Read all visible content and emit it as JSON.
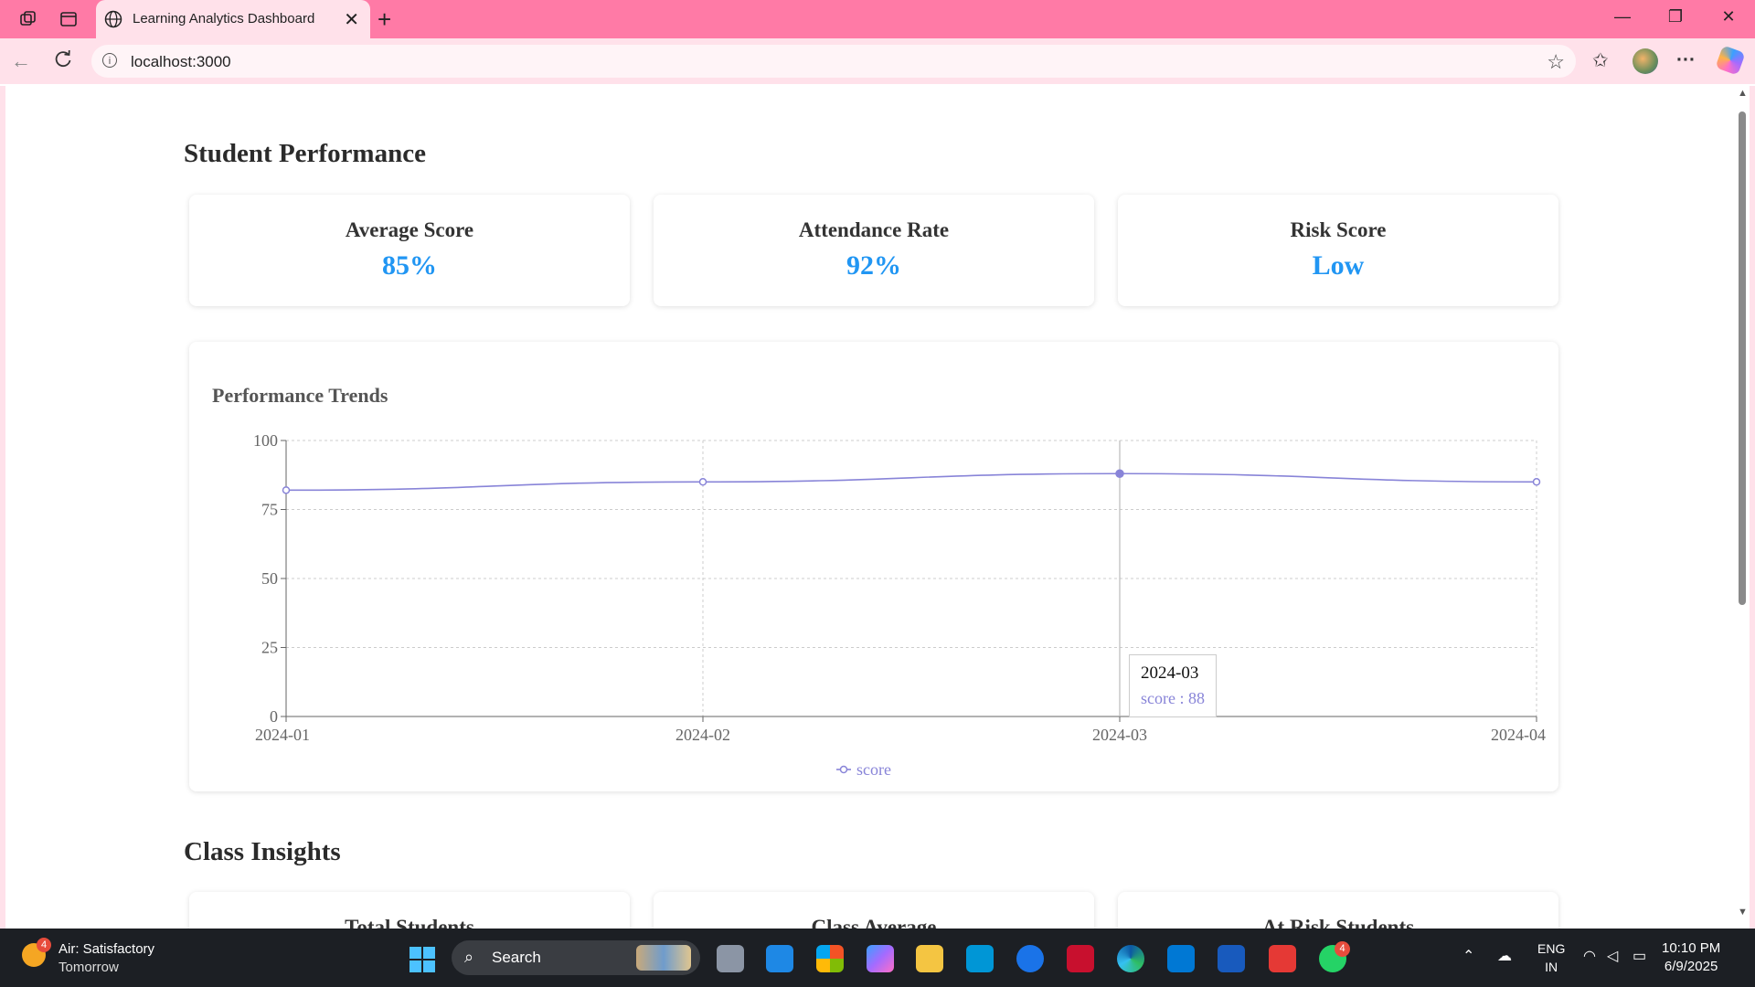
{
  "browser": {
    "tab_title": "Learning Analytics Dashboard",
    "url": "localhost:3000"
  },
  "page": {
    "performance_section_title": "Student Performance",
    "stats": [
      {
        "label": "Average Score",
        "value": "85%"
      },
      {
        "label": "Attendance Rate",
        "value": "92%"
      },
      {
        "label": "Risk Score",
        "value": "Low"
      }
    ],
    "chart_card_title": "Performance Trends",
    "tooltip": {
      "label": "2024-03",
      "text": "score : 88"
    },
    "class_section_title": "Class Insights",
    "class_stats": [
      {
        "label": "Total Students"
      },
      {
        "label": "Class Average"
      },
      {
        "label": "At Risk Students"
      }
    ]
  },
  "chart_data": {
    "type": "line",
    "title": "Performance Trends",
    "x": [
      "2024-01",
      "2024-02",
      "2024-03",
      "2024-04"
    ],
    "series": [
      {
        "name": "score",
        "values": [
          82,
          85,
          88,
          85
        ],
        "color": "#8884d8"
      }
    ],
    "ylim": [
      0,
      100
    ],
    "yticks": [
      0,
      25,
      50,
      75,
      100
    ],
    "grid": true,
    "legend": "bottom-center",
    "active_index": 2
  },
  "taskbar": {
    "weather_title": "Air: Satisfactory",
    "weather_sub": "Tomorrow",
    "weather_badge": "4",
    "search_label": "Search",
    "whatsapp_badge": "4",
    "lang_1": "ENG",
    "lang_2": "IN",
    "time": "10:10 PM",
    "date": "6/9/2025"
  },
  "colors": {
    "accent_blue": "#2196f3",
    "series_purple": "#8884d8",
    "browser_pink": "#ff7aa6"
  }
}
